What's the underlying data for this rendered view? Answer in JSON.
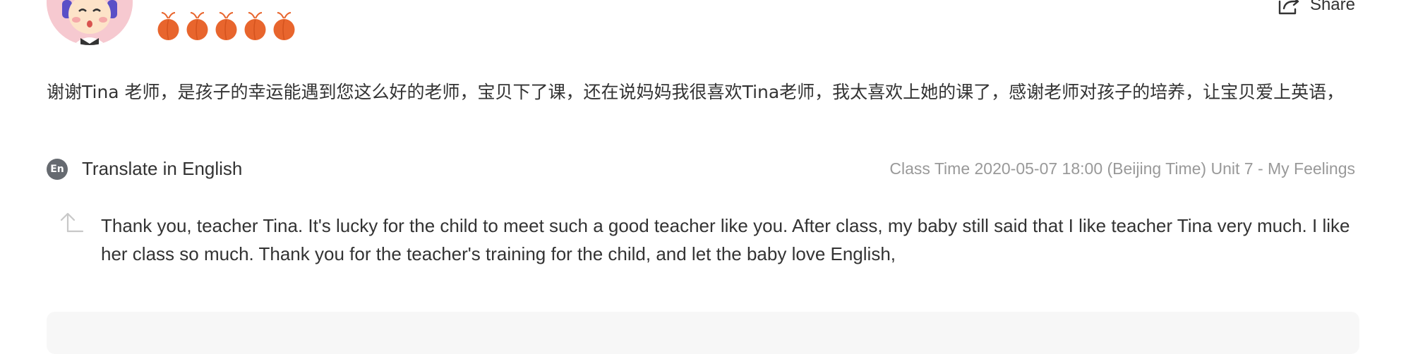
{
  "review": {
    "avatar_icon": "teacher-avatar-illustration",
    "rating": {
      "value": 5,
      "max": 5,
      "icon": "peach-icon",
      "color": "#e8652d"
    },
    "share": {
      "icon": "share-icon",
      "label": "Share"
    },
    "comment_text": "谢谢Tina 老师，是孩子的幸运能遇到您这么好的老师，宝贝下了课，还在说妈妈我很喜欢Tina老师，我太喜欢上她的课了，感谢老师对孩子的培养，让宝贝爱上英语，",
    "translate": {
      "badge": "En",
      "label": "Translate in English"
    },
    "class_time": "Class Time 2020-05-07 18:00 (Beijing Time) Unit 7 - My Feelings",
    "translation": {
      "icon": "reply-arrow-icon",
      "text": "Thank you, teacher Tina. It's lucky for the child to meet such a good teacher like you. After class, my baby still said that I like teacher Tina very much. I like her class so much. Thank you for the teacher's training for the child, and let the baby love English,"
    }
  }
}
